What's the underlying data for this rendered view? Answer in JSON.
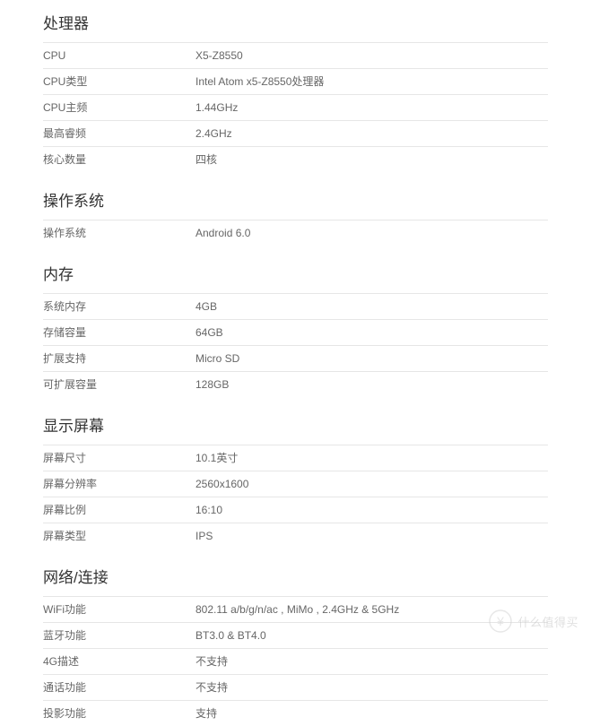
{
  "sections": [
    {
      "title": "处理器",
      "rows": [
        {
          "label": "CPU",
          "value": "X5-Z8550"
        },
        {
          "label": "CPU类型",
          "value": "Intel Atom x5-Z8550处理器"
        },
        {
          "label": "CPU主频",
          "value": "1.44GHz"
        },
        {
          "label": "最高睿频",
          "value": "2.4GHz"
        },
        {
          "label": "核心数量",
          "value": "四核"
        }
      ]
    },
    {
      "title": "操作系统",
      "rows": [
        {
          "label": "操作系统",
          "value": "Android 6.0"
        }
      ]
    },
    {
      "title": "内存",
      "rows": [
        {
          "label": "系统内存",
          "value": "4GB"
        },
        {
          "label": "存储容量",
          "value": "64GB"
        },
        {
          "label": "扩展支持",
          "value": "Micro SD"
        },
        {
          "label": "可扩展容量",
          "value": "128GB"
        }
      ]
    },
    {
      "title": "显示屏幕",
      "rows": [
        {
          "label": "屏幕尺寸",
          "value": "10.1英寸"
        },
        {
          "label": "屏幕分辨率",
          "value": "2560x1600"
        },
        {
          "label": "屏幕比例",
          "value": "16:10"
        },
        {
          "label": "屏幕类型",
          "value": "IPS"
        }
      ]
    },
    {
      "title": "网络/连接",
      "rows": [
        {
          "label": "WiFi功能",
          "value": "802.11 a/b/g/n/ac , MiMo , 2.4GHz & 5GHz"
        },
        {
          "label": "蓝牙功能",
          "value": "BT3.0 & BT4.0"
        },
        {
          "label": "4G描述",
          "value": "不支持"
        },
        {
          "label": "通话功能",
          "value": "不支持"
        },
        {
          "label": "投影功能",
          "value": "支持"
        }
      ]
    }
  ],
  "watermark": {
    "text": "什么值得买",
    "currency": "¥"
  }
}
